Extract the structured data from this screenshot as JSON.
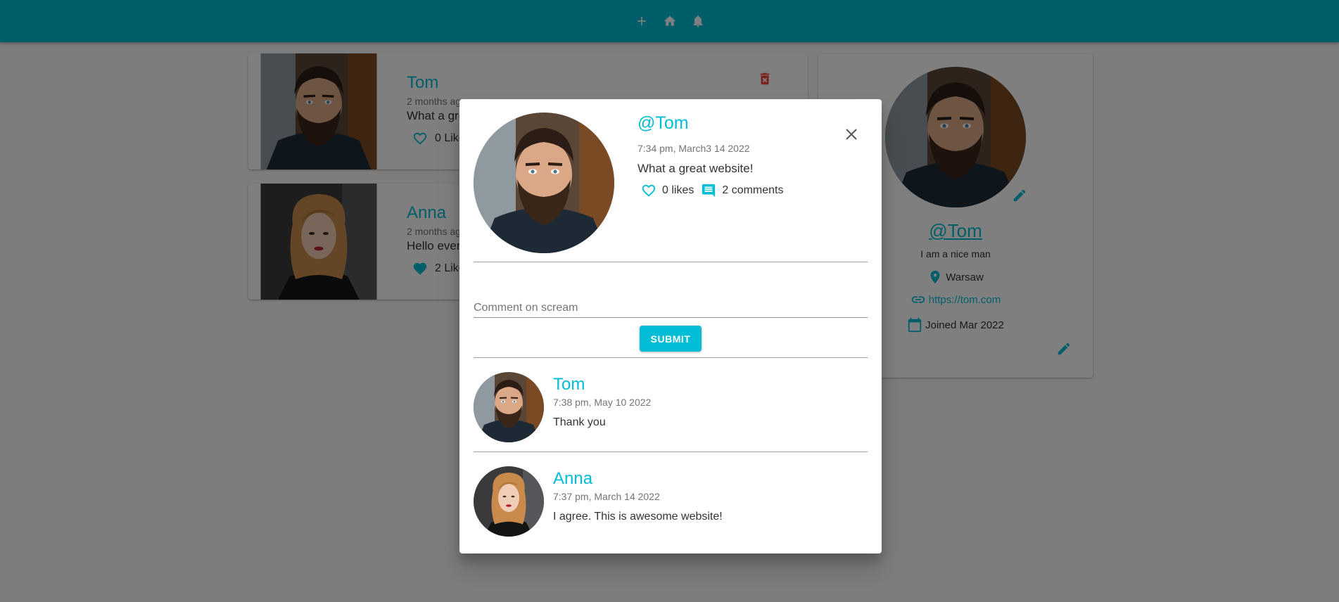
{
  "navbar": {
    "icons": [
      "plus-icon",
      "home-icon",
      "bell-icon"
    ]
  },
  "screams": [
    {
      "user": "Tom",
      "date": "2 months ago",
      "body": "What a great website!",
      "likes": "0 Likes",
      "liked": false,
      "photo": "bearded-man"
    },
    {
      "user": "Anna",
      "date": "2 months ago",
      "body": "Hello everyone!",
      "likes": "2 Likes",
      "liked": true,
      "photo": "red-haired-woman"
    }
  ],
  "profile": {
    "handle": "@Tom",
    "bio": "I am a nice man",
    "location": "Warsaw",
    "website": "https://tom.com",
    "joined": "Joined Mar 2022"
  },
  "dialog": {
    "handle": "@Tom",
    "date": "7:34 pm, March3 14 2022",
    "body": "What a great website!",
    "likes": "0 likes",
    "comments": "2 comments",
    "comment_placeholder": "Comment on scream",
    "submit_label": "SUBMIT",
    "comment_list": [
      {
        "user": "Tom",
        "date": "7:38 pm, May 10 2022",
        "body": "Thank you",
        "photo": "bearded-man"
      },
      {
        "user": "Anna",
        "date": "7:37 pm, March 14 2022",
        "body": "I agree. This is awesome website!",
        "photo": "red-haired-woman"
      }
    ]
  },
  "colors": {
    "primary": "#00bcd4",
    "delete": "#f44336",
    "overlay": "rgba(0,0,0,0.5)"
  }
}
